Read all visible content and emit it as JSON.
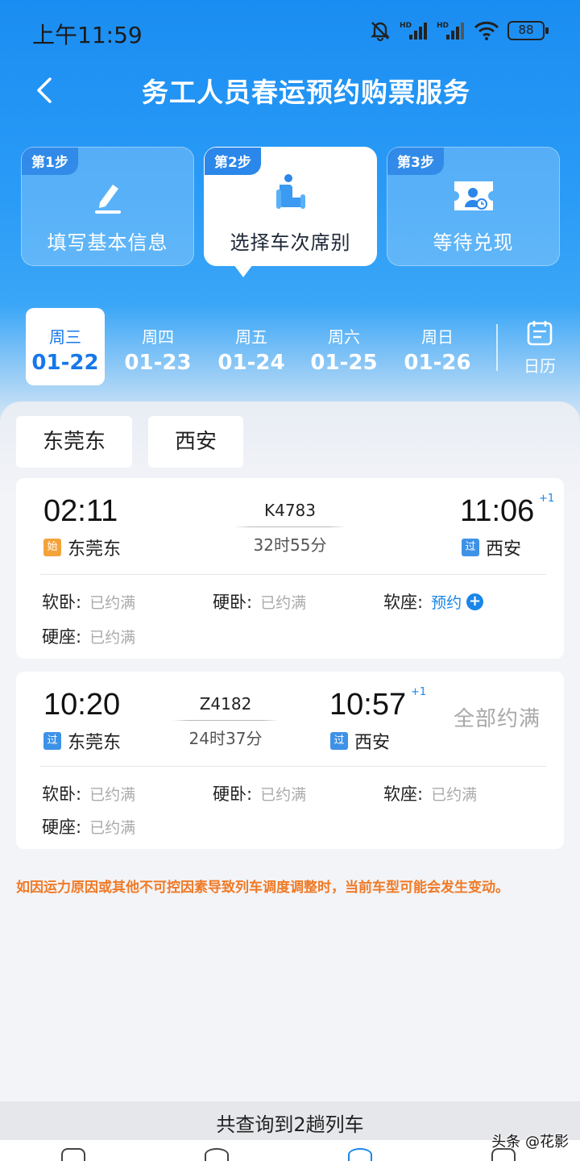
{
  "status_bar": {
    "time": "上午11:59",
    "battery": "88",
    "icons": [
      "mute-bell-icon",
      "hd-signal-icon",
      "hd-signal-icon",
      "wifi-icon",
      "battery-icon"
    ]
  },
  "nav": {
    "title": "务工人员春运预约购票服务",
    "back_icon": "back-chevron-icon"
  },
  "steps": [
    {
      "badge": "第1步",
      "label": "填写基本信息",
      "icon": "pencil-icon",
      "active": false
    },
    {
      "badge": "第2步",
      "label": "选择车次席别",
      "icon": "seat-icon",
      "active": true
    },
    {
      "badge": "第3步",
      "label": "等待兑现",
      "icon": "ticket-user-icon",
      "active": false
    }
  ],
  "dates": [
    {
      "weekday": "周三",
      "date": "01-22",
      "selected": true
    },
    {
      "weekday": "周四",
      "date": "01-23",
      "selected": false
    },
    {
      "weekday": "周五",
      "date": "01-24",
      "selected": false
    },
    {
      "weekday": "周六",
      "date": "01-25",
      "selected": false
    },
    {
      "weekday": "周日",
      "date": "01-26",
      "selected": false
    }
  ],
  "calendar": {
    "label": "日历",
    "icon": "calendar-icon"
  },
  "stations": {
    "from": "东莞东",
    "to": "西安"
  },
  "trains": [
    {
      "depart_time": "02:11",
      "depart_tag": "始",
      "depart_station": "东莞东",
      "train_no": "K4783",
      "duration": "32时55分",
      "arrive_time": "11:06",
      "arrive_day_offset": "+1",
      "arrive_tag": "过",
      "arrive_station": "西安",
      "seats": [
        {
          "type": "软卧:",
          "status": "已约满"
        },
        {
          "type": "硬卧:",
          "status": "已约满"
        },
        {
          "type": "软座:",
          "status": "预约"
        },
        {
          "type": "硬座:",
          "status": "已约满"
        }
      ]
    },
    {
      "depart_time": "10:20",
      "depart_tag": "过",
      "depart_station": "东莞东",
      "train_no": "Z4182",
      "duration": "24时37分",
      "arrive_time": "10:57",
      "arrive_day_offset": "+1",
      "arrive_tag": "过",
      "arrive_station": "西安",
      "status_text": "全部约满",
      "seats": [
        {
          "type": "软卧:",
          "status": "已约满"
        },
        {
          "type": "硬卧:",
          "status": "已约满"
        },
        {
          "type": "软座:",
          "status": "已约满"
        },
        {
          "type": "硬座:",
          "status": "已约满"
        }
      ]
    }
  ],
  "notice": "如因运力原因或其他不可控因素导致列车调度调整时，当前车型可能会发生变动。",
  "footer": {
    "summary": "共查询到2趟列车"
  },
  "watermark": "头条 @花影",
  "colors": {
    "primary": "#1a86e8",
    "warning": "#f07a26",
    "start_tag": "#f3a33a"
  }
}
